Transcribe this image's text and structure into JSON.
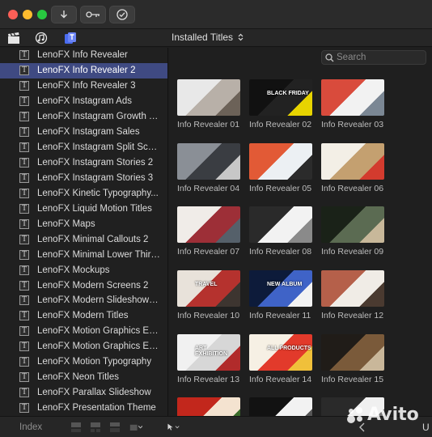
{
  "window": {
    "traffic_lights": [
      "#fe5f57",
      "#febc2e",
      "#28c840"
    ]
  },
  "toolbar": {
    "browser_dropdown": "Installed Titles",
    "dropdown_chevron": "⌃⌄"
  },
  "search": {
    "placeholder": "Search"
  },
  "sidebar": {
    "items": [
      {
        "label": "LenoFX Info Revealer"
      },
      {
        "label": "LenoFX Info Revealer 2",
        "selected": true
      },
      {
        "label": "LenoFX Info Revealer 3"
      },
      {
        "label": "LenoFX Instagram Ads"
      },
      {
        "label": "LenoFX Instagram Growth To..."
      },
      {
        "label": "LenoFX Instagram Sales"
      },
      {
        "label": "LenoFX Instagram Split Screen"
      },
      {
        "label": "LenoFX Instagram Stories 2"
      },
      {
        "label": "LenoFX Instagram Stories 3"
      },
      {
        "label": "LenoFX Kinetic Typography..."
      },
      {
        "label": "LenoFX Liquid Motion Titles"
      },
      {
        "label": "LenoFX Maps"
      },
      {
        "label": "LenoFX Minimal Callouts 2"
      },
      {
        "label": "LenoFX Minimal Lower Third..."
      },
      {
        "label": "LenoFX Mockups"
      },
      {
        "label": "LenoFX Modern Screens 2"
      },
      {
        "label": "LenoFX Modern Slideshow T..."
      },
      {
        "label": "LenoFX Modern Titles"
      },
      {
        "label": "LenoFX Motion Graphics Ele..."
      },
      {
        "label": "LenoFX Motion Graphics Ele..."
      },
      {
        "label": "LenoFX Motion Typography"
      },
      {
        "label": "LenoFX Neon Titles"
      },
      {
        "label": "LenoFX Parallax Slideshow"
      },
      {
        "label": "LenoFX Presentation Theme"
      }
    ],
    "title_icon_glyph": "T",
    "selected_color": "#3f4a82"
  },
  "thumbnails": [
    {
      "label": "Info Revealer 01"
    },
    {
      "label": "Info Revealer 02",
      "overlay_text": "BLACK FRIDAY"
    },
    {
      "label": "Info Revealer 03"
    },
    {
      "label": "Info Revealer 04"
    },
    {
      "label": "Info Revealer 05"
    },
    {
      "label": "Info Revealer 06"
    },
    {
      "label": "Info Revealer 07"
    },
    {
      "label": "Info Revealer 08"
    },
    {
      "label": "Info Revealer 09"
    },
    {
      "label": "Info Revealer 10",
      "overlay_text": "TRAVEL"
    },
    {
      "label": "Info Revealer 11",
      "overlay_text": "NEW ALBUM"
    },
    {
      "label": "Info Revealer 12"
    },
    {
      "label": "Info Revealer 13",
      "overlay_text": "ART EXHIBITION"
    },
    {
      "label": "Info Revealer 14",
      "overlay_text": "ALL PRODUCTS"
    },
    {
      "label": "Info Revealer 15"
    },
    {
      "label": ""
    },
    {
      "label": ""
    },
    {
      "label": ""
    }
  ],
  "bottom_bar": {
    "index_label": "Index",
    "right_label": "U"
  },
  "watermark": {
    "text": "Avito"
  },
  "icons": {
    "download": "download-icon",
    "key": "key-icon",
    "check": "checkmark-circle-icon",
    "clapper": "clapper-icon",
    "music": "music-photos-icon",
    "titles": "titles-generators-icon",
    "search": "search-icon",
    "pointer": "pointer-tool-icon"
  }
}
